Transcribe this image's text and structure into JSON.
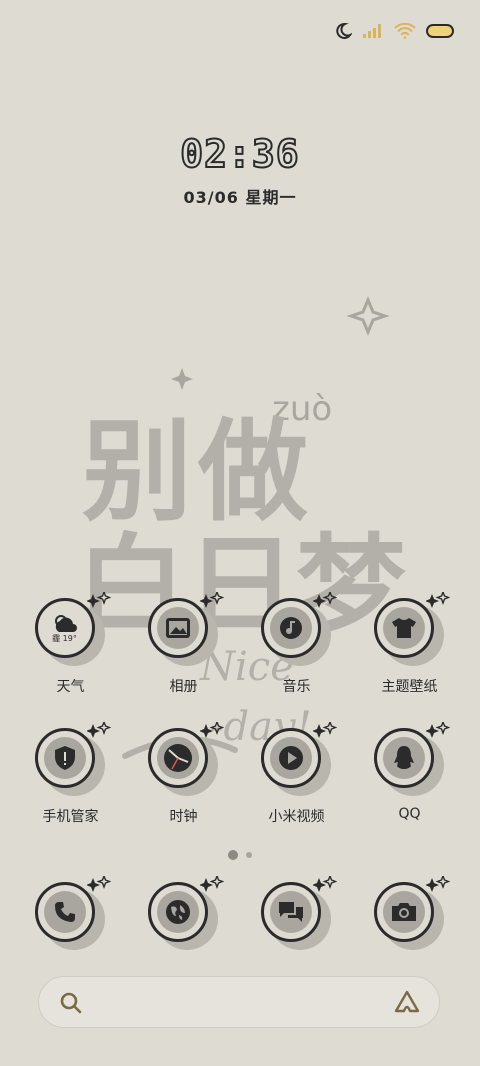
{
  "status_bar": {
    "icons": [
      "moon-icon",
      "signal-icon",
      "wifi-icon",
      "battery-icon"
    ]
  },
  "lock_clock": {
    "time": "02:36",
    "date": "03/06 星期一"
  },
  "wallpaper": {
    "pinyin": "zuò",
    "title_line1": "别做",
    "title_line2": "白日梦",
    "script_line1": "Nice",
    "script_line2": "-day!"
  },
  "apps_row1": [
    {
      "label": "天气",
      "icon": "weather-icon",
      "badge": "霾 19°"
    },
    {
      "label": "相册",
      "icon": "gallery-icon"
    },
    {
      "label": "音乐",
      "icon": "music-icon"
    },
    {
      "label": "主题壁纸",
      "icon": "tshirt-icon"
    }
  ],
  "apps_row2": [
    {
      "label": "手机管家",
      "icon": "shield-icon"
    },
    {
      "label": "时钟",
      "icon": "clock-icon"
    },
    {
      "label": "小米视频",
      "icon": "play-icon"
    },
    {
      "label": "QQ",
      "icon": "penguin-icon"
    }
  ],
  "page_indicator": {
    "pages": 2,
    "current": 1
  },
  "dock": [
    "phone-icon",
    "browser-icon",
    "messages-icon",
    "camera-icon"
  ],
  "search_bar": {
    "left_icon": "search-icon",
    "right_icon": "assistant-icon"
  }
}
